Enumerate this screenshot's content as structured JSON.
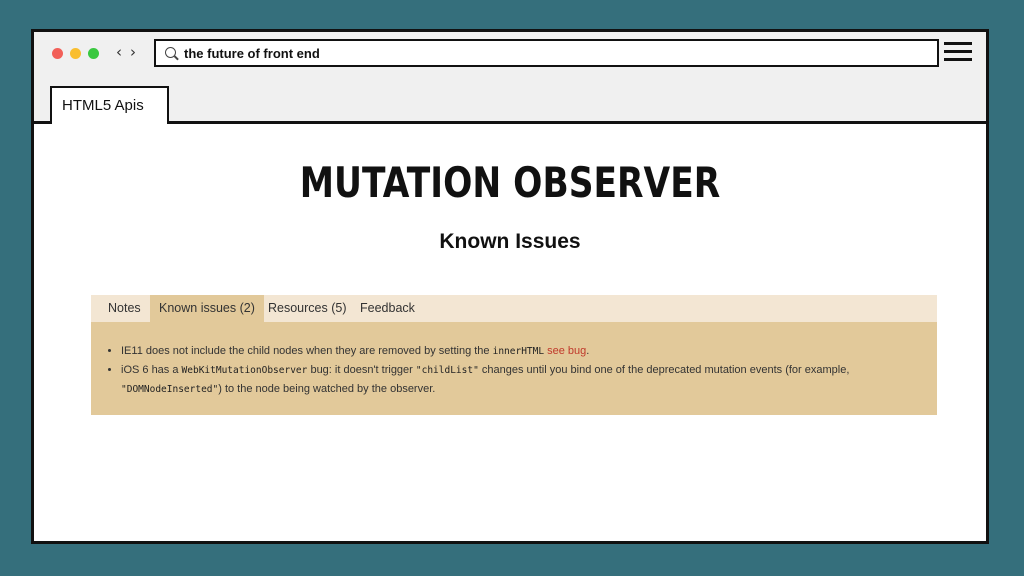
{
  "browser": {
    "address": "the future of front end",
    "tab_label": "HTML5 Apis"
  },
  "page": {
    "title": "MUTATION OBSERVER",
    "subtitle": "Known Issues"
  },
  "panel": {
    "tabs": [
      {
        "label": "Notes"
      },
      {
        "label": "Known issues (2)"
      },
      {
        "label": "Resources (5)"
      },
      {
        "label": "Feedback"
      }
    ],
    "issue1": {
      "text1": "IE11 does not include the child nodes when they are removed by setting the ",
      "code1": "innerHTML",
      "link": "see bug",
      "text2": "."
    },
    "issue2": {
      "text1": "iOS 6 has a ",
      "code1": "WebKitMutationObserver",
      "text2": " bug: it doesn't trigger ",
      "code2": "\"childList\"",
      "text3": " changes until you bind one of the deprecated mutation events (for example, ",
      "code3": "\"DOMNodeInserted\"",
      "text4": ") to the node being watched by the observer."
    }
  },
  "colors": {
    "background": "#356f7c",
    "panel_tabs": "#f3e6d3",
    "panel_body": "#e2c99a",
    "link": "#c0392b"
  }
}
